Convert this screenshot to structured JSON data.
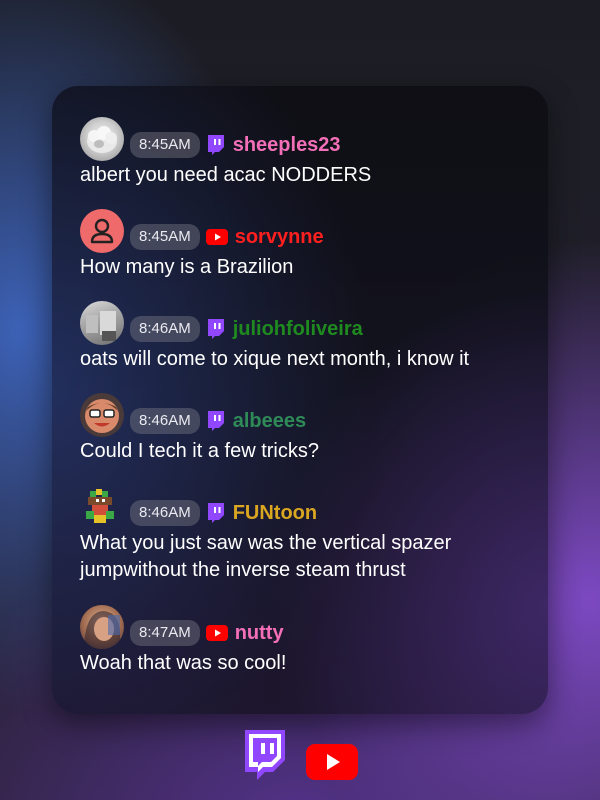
{
  "messages": [
    {
      "time": "8:45AM",
      "platform": "twitch",
      "user": "sheeples23",
      "color": "#f36fb8",
      "text": "albert you need acac NODDERS",
      "avatar": "sheep-photo-avatar"
    },
    {
      "time": "8:45AM",
      "platform": "youtube",
      "user": "sorvynne",
      "color": "#ff1f1f",
      "text": "How many is a Brazilion",
      "avatar": "default-user-avatar"
    },
    {
      "time": "8:46AM",
      "platform": "twitch",
      "user": "juliohfoliveira",
      "color": "#1f8a1f",
      "text": "oats will come to xique next month, i know it",
      "avatar": "photo-avatar"
    },
    {
      "time": "8:46AM",
      "platform": "twitch",
      "user": "albeees",
      "color": "#2e8b57",
      "text": "Could I tech it a few tricks?",
      "avatar": "cartoon-face-avatar"
    },
    {
      "time": "8:46AM",
      "platform": "twitch",
      "user": "FUNtoon",
      "color": "#daa520",
      "text": "What you just saw was the vertical spazer jumpwithout the inverse steam thrust",
      "avatar": "pixel-art-avatar"
    },
    {
      "time": "8:47AM",
      "platform": "youtube",
      "user": "nutty",
      "color": "#f36fb8",
      "text": "Woah that was so cool!",
      "avatar": "photo-avatar"
    }
  ],
  "colors": {
    "twitch": "#9146ff",
    "youtube": "#ff0000"
  },
  "footer": {
    "icons": [
      "twitch-logo-icon",
      "youtube-logo-icon"
    ]
  }
}
